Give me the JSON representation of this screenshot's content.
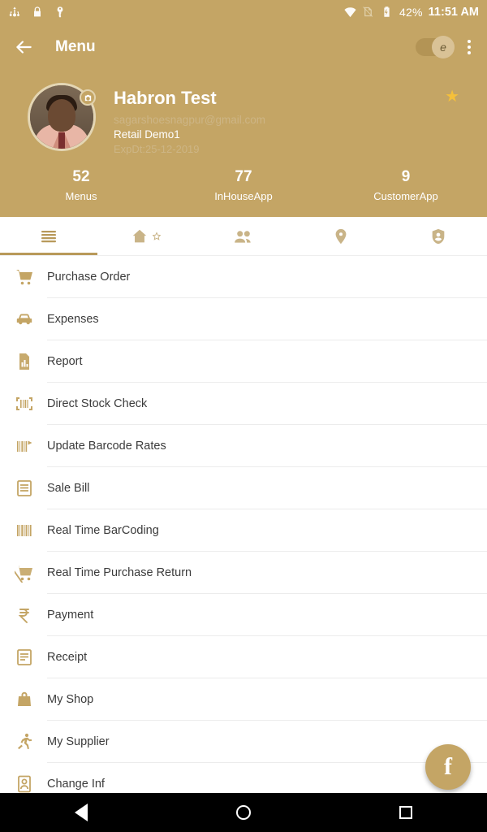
{
  "status_bar": {
    "icons_left": [
      "usb-icon",
      "lock-icon",
      "key-icon"
    ],
    "icons_right": [
      "wifi-icon",
      "sim-icon",
      "battery-icon"
    ],
    "battery_text": "42%",
    "time": "11:51 AM"
  },
  "app_bar": {
    "back_icon": "back-arrow-icon",
    "title": "Menu",
    "toggle_label": "e",
    "overflow_icon": "more-vertical-icon"
  },
  "profile": {
    "avatar_name": "user-avatar",
    "camera_badge": "camera-icon",
    "name": "Habron Test",
    "email": "sagarshoesnagpur@gmail.com",
    "plan": "Retail Demo1",
    "expiry": "ExpDt:25-12-2019",
    "star_icon": "star-icon"
  },
  "stats": [
    {
      "value": "52",
      "label": "Menus"
    },
    {
      "value": "77",
      "label": "InHouseApp"
    },
    {
      "value": "9",
      "label": "CustomerApp"
    }
  ],
  "tabs": [
    {
      "icon": "list-menu-icon",
      "active": true
    },
    {
      "icon": "home-star-icon",
      "active": false
    },
    {
      "icon": "people-icon",
      "active": false
    },
    {
      "icon": "location-pin-icon",
      "active": false
    },
    {
      "icon": "account-badge-icon",
      "active": false
    }
  ],
  "menu_items": [
    {
      "icon": "shopping-cart-icon",
      "label": "Purchase Order"
    },
    {
      "icon": "car-icon",
      "label": "Expenses"
    },
    {
      "icon": "report-chart-icon",
      "label": "Report"
    },
    {
      "icon": "barcode-scan-icon",
      "label": "Direct Stock Check"
    },
    {
      "icon": "barcode-rates-icon",
      "label": "Update Barcode Rates"
    },
    {
      "icon": "bill-lines-icon",
      "label": "Sale Bill"
    },
    {
      "icon": "barcode-icon",
      "label": "Real Time BarCoding"
    },
    {
      "icon": "cart-return-icon",
      "label": "Real Time Purchase Return"
    },
    {
      "icon": "rupee-icon",
      "label": "Payment"
    },
    {
      "icon": "receipt-icon",
      "label": "Receipt"
    },
    {
      "icon": "shop-bag-icon",
      "label": "My Shop"
    },
    {
      "icon": "running-person-icon",
      "label": "My Supplier"
    },
    {
      "icon": "contact-card-icon",
      "label": "Change Inf"
    }
  ],
  "fab": {
    "icon": "facebook-icon",
    "label": "f"
  },
  "nav_bar": {
    "back": "nav-back-icon",
    "home": "nav-home-icon",
    "recents": "nav-recents-icon"
  },
  "colors": {
    "brand": "#c4a565",
    "accent": "#b8995a",
    "star": "#f5c03a",
    "text": "#3b3b3b"
  }
}
